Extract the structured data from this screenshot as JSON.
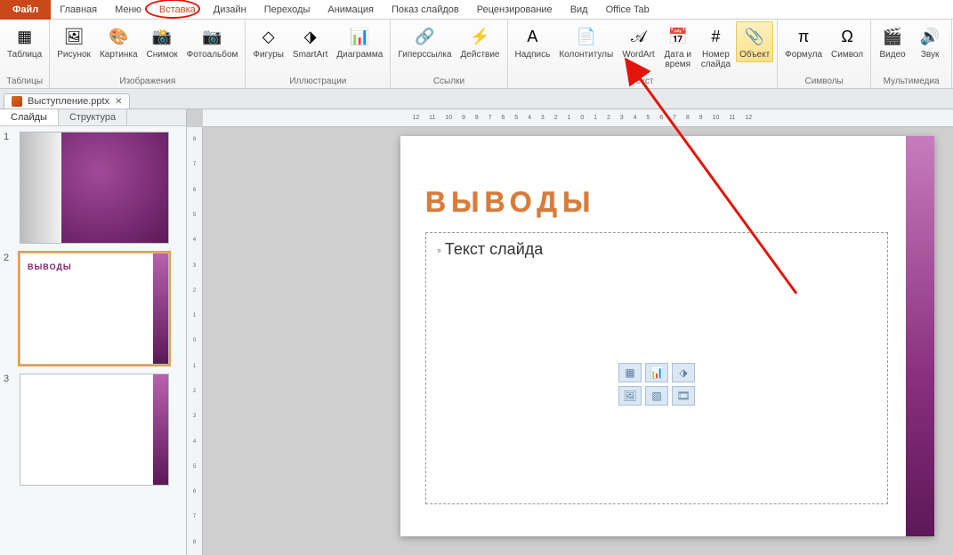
{
  "tabs": {
    "file": "Файл",
    "items": [
      "Главная",
      "Меню",
      "Вставка",
      "Дизайн",
      "Переходы",
      "Анимация",
      "Показ слайдов",
      "Рецензирование",
      "Вид",
      "Office Tab"
    ],
    "active": "Вставка"
  },
  "ribbon": {
    "groups": [
      {
        "label": "Таблицы",
        "buttons": [
          {
            "id": "table",
            "label": "Таблица"
          }
        ]
      },
      {
        "label": "Изображения",
        "buttons": [
          {
            "id": "picture",
            "label": "Рисунок"
          },
          {
            "id": "clipart",
            "label": "Картинка"
          },
          {
            "id": "screenshot",
            "label": "Снимок"
          },
          {
            "id": "photoalbum",
            "label": "Фотоальбом"
          }
        ]
      },
      {
        "label": "Иллюстрации",
        "buttons": [
          {
            "id": "shapes",
            "label": "Фигуры"
          },
          {
            "id": "smartart",
            "label": "SmartArt"
          },
          {
            "id": "chart",
            "label": "Диаграмма"
          }
        ]
      },
      {
        "label": "Ссылки",
        "buttons": [
          {
            "id": "hyperlink",
            "label": "Гиперссылка"
          },
          {
            "id": "action",
            "label": "Действие"
          }
        ]
      },
      {
        "label": "Текст",
        "buttons": [
          {
            "id": "textbox",
            "label": "Надпись"
          },
          {
            "id": "headerfooter",
            "label": "Колонтитулы"
          },
          {
            "id": "wordart",
            "label": "WordArt"
          },
          {
            "id": "datetime",
            "label": "Дата и\nвремя"
          },
          {
            "id": "slidenum",
            "label": "Номер\nслайда"
          },
          {
            "id": "object",
            "label": "Объект",
            "highlight": true
          }
        ]
      },
      {
        "label": "Символы",
        "buttons": [
          {
            "id": "equation",
            "label": "Формула"
          },
          {
            "id": "symbol",
            "label": "Символ"
          }
        ]
      },
      {
        "label": "Мультимедиа",
        "buttons": [
          {
            "id": "video",
            "label": "Видео"
          },
          {
            "id": "audio",
            "label": "Звук"
          }
        ]
      }
    ]
  },
  "document": {
    "name": "Выступление.pptx"
  },
  "leftpanel": {
    "tabs": [
      "Слайды",
      "Структура"
    ],
    "active": "Слайды",
    "slides": [
      {
        "num": "1"
      },
      {
        "num": "2",
        "title": "ВЫВОДЫ",
        "selected": true
      },
      {
        "num": "3"
      }
    ]
  },
  "slide": {
    "title": "ВЫВОДЫ",
    "body_placeholder": "Текст слайда"
  },
  "ruler": {
    "h": [
      "12",
      "11",
      "10",
      "9",
      "8",
      "7",
      "6",
      "5",
      "4",
      "3",
      "2",
      "1",
      "0",
      "1",
      "2",
      "3",
      "4",
      "5",
      "6",
      "7",
      "8",
      "9",
      "10",
      "11",
      "12"
    ],
    "v": [
      "8",
      "7",
      "6",
      "5",
      "4",
      "3",
      "2",
      "1",
      "0",
      "1",
      "2",
      "3",
      "4",
      "5",
      "6",
      "7",
      "8"
    ]
  },
  "annotations": {
    "circled_tab": "Вставка",
    "arrow_target": "object"
  }
}
